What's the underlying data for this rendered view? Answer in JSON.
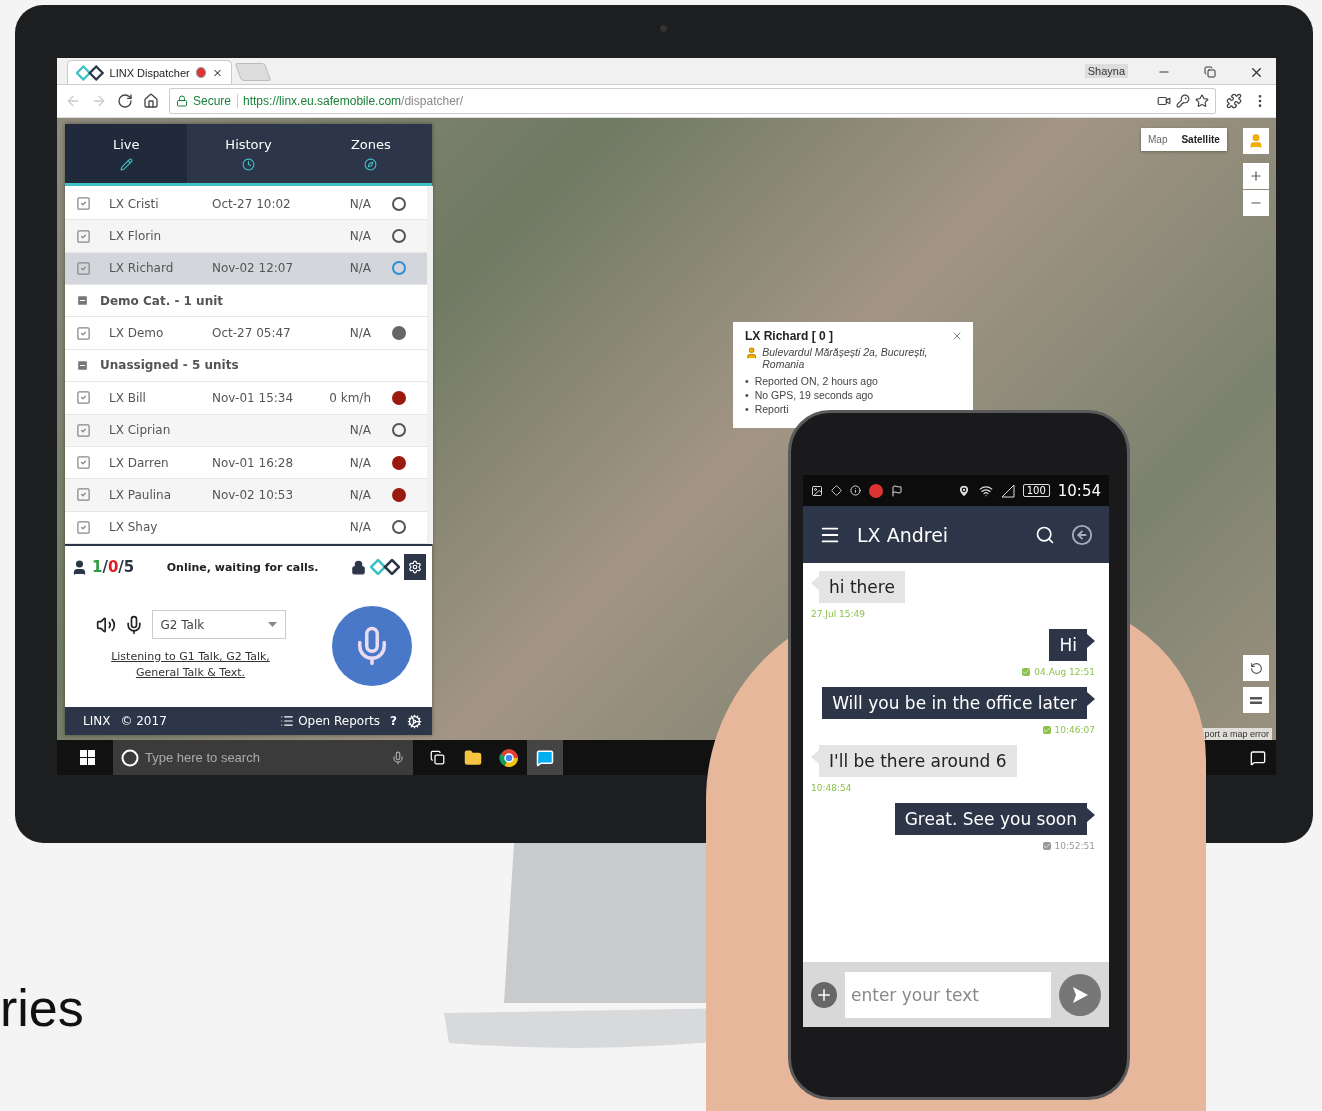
{
  "browser": {
    "tab_title": "LINX Dispatcher",
    "recording": true,
    "profile": "Shayna",
    "secure_label": "Secure",
    "url_host": "https://linx.eu.safemobile.com",
    "url_path": "/dispatcher/"
  },
  "panel": {
    "tabs": [
      {
        "label": "Live",
        "selected": true
      },
      {
        "label": "History",
        "selected": false
      },
      {
        "label": "Zones",
        "selected": false
      }
    ],
    "rows": [
      {
        "kind": "unit",
        "name": "LX Cristi",
        "time": "Oct-27 10:02",
        "speed": "N/A",
        "color": "#555555",
        "filled": false,
        "checked": true,
        "selected": false
      },
      {
        "kind": "unit",
        "name": "LX Florin",
        "speed": "N/A",
        "color": "#555555",
        "filled": false,
        "checked": true,
        "selected": false
      },
      {
        "kind": "unit",
        "name": "LX Richard",
        "time": "Nov-02 12:07",
        "speed": "N/A",
        "color": "#2b8fd8",
        "filled": false,
        "checked": true,
        "selected": true
      },
      {
        "kind": "group",
        "label": "Demo Cat. - 1 unit",
        "expanded": true
      },
      {
        "kind": "unit",
        "name": "LX Demo",
        "time": "Oct-27 05:47",
        "speed": "N/A",
        "color": "#666666",
        "filled": true,
        "checked": true,
        "selected": false
      },
      {
        "kind": "group",
        "label": "Unassigned - 5 units",
        "expanded": true
      },
      {
        "kind": "unit",
        "name": "LX Bill",
        "time": "Nov-01 15:34",
        "speed": "0 km/h",
        "color": "#9a1b0e",
        "filled": true,
        "checked": true,
        "selected": false
      },
      {
        "kind": "unit",
        "name": "LX Ciprian",
        "speed": "N/A",
        "color": "#555555",
        "filled": false,
        "checked": true,
        "selected": false
      },
      {
        "kind": "unit",
        "name": "LX Darren",
        "time": "Nov-01 16:28",
        "speed": "N/A",
        "color": "#9a1b0e",
        "filled": true,
        "checked": true,
        "selected": false
      },
      {
        "kind": "unit",
        "name": "LX Paulina",
        "time": "Nov-02 10:53",
        "speed": "N/A",
        "color": "#9a1b0e",
        "filled": true,
        "checked": true,
        "selected": false
      },
      {
        "kind": "unit",
        "name": "LX Shay",
        "speed": "N/A",
        "color": "#555555",
        "filled": false,
        "checked": true,
        "selected": false
      }
    ],
    "counter": [
      "1",
      "/",
      "0",
      "/",
      "5"
    ],
    "status_text": "Online, waiting for calls.",
    "talkgroup": "G2 Talk",
    "listening": "Listening to G1 Talk, G2 Talk, General Talk & Text.",
    "footer": {
      "brand": "LINX",
      "copyright": "© 2017",
      "reports": "Open Reports",
      "help": "?"
    }
  },
  "map": {
    "map_types": [
      {
        "label": "Map",
        "selected": false
      },
      {
        "label": "Satellite",
        "selected": true
      }
    ],
    "popup": {
      "title": "LX Richard [ 0 ]",
      "address": "Bulevardul Mărășești 2a, București, Romania",
      "bullet": "•",
      "items": [
        "Reported ON, 2 hours ago",
        "No GPS, 19 seconds ago",
        "Reporti"
      ]
    },
    "report_link": "port a map error"
  },
  "taskbar": {
    "search_placeholder": "Type here to search"
  },
  "phone": {
    "battery": "100",
    "clock": "10:54",
    "title": "LX Andrei",
    "messages": [
      {
        "kind": "in",
        "text": "hi there",
        "time": "27.Jul 15:49"
      },
      {
        "kind": "out",
        "text": "Hi",
        "time": "04.Aug 12:51",
        "delivered": true
      },
      {
        "kind": "out",
        "text": "Will you be in the office later",
        "time": "10:46:07",
        "delivered": true
      },
      {
        "kind": "in",
        "text": "I'll be there around 6",
        "time": "10:48:54"
      },
      {
        "kind": "out",
        "text": "Great. See you soon",
        "time": "10:52:51",
        "delivered": false
      }
    ],
    "input_placeholder": "enter your text"
  },
  "caption": "ries"
}
